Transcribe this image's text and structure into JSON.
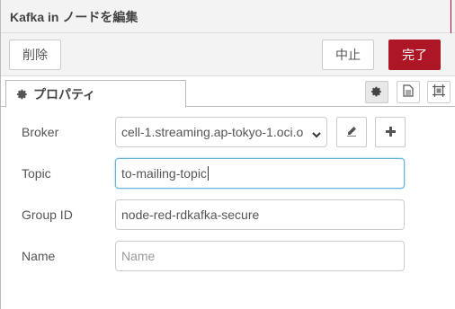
{
  "dialog": {
    "title": "Kafka in ノードを編集"
  },
  "toolbar": {
    "delete_label": "削除",
    "cancel_label": "中止",
    "done_label": "完了"
  },
  "tabs": {
    "properties_label": "プロパティ"
  },
  "form": {
    "broker": {
      "label": "Broker",
      "value": "cell-1.streaming.ap-tokyo-1.oci.o"
    },
    "topic": {
      "label": "Topic",
      "value": "to-mailing-topic"
    },
    "group_id": {
      "label": "Group ID",
      "value": "node-red-rdkafka-secure"
    },
    "name": {
      "label": "Name",
      "value": "",
      "placeholder": "Name"
    }
  },
  "colors": {
    "done_button": "#ad1625",
    "focus_border": "#67b2d6"
  },
  "icons": [
    "gear-icon",
    "document-icon",
    "frame-icon",
    "pencil-icon",
    "plus-icon",
    "chevron-down-icon"
  ]
}
